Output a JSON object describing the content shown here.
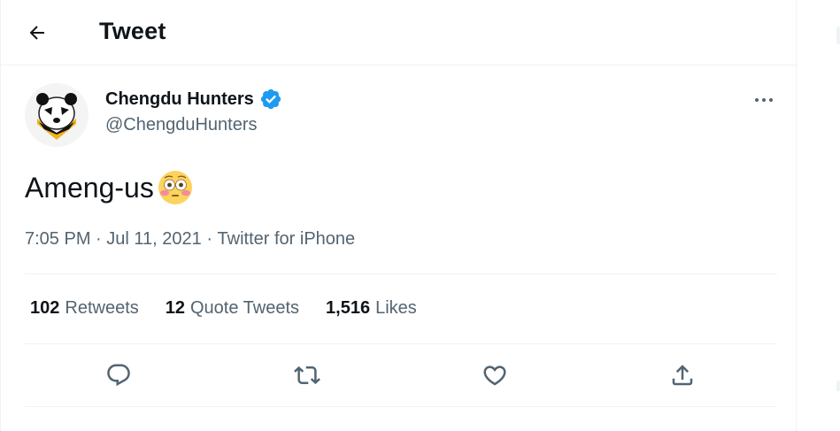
{
  "header": {
    "title": "Tweet",
    "back_icon": "arrow-left-icon"
  },
  "author": {
    "display_name": "Chengdu Hunters",
    "handle": "@ChengduHunters",
    "verified": true,
    "verified_color": "#1d9bf0",
    "avatar_icon": "panda-logo"
  },
  "tweet": {
    "text": "Ameng-us",
    "emoji": "flushed-face-emoji",
    "time": "7:05 PM",
    "date": "Jul 11, 2021",
    "source": "Twitter for iPhone",
    "separator": " · "
  },
  "stats": {
    "retweets_count": "102",
    "retweets_label": "Retweets",
    "quotes_count": "12",
    "quotes_label": "Quote Tweets",
    "likes_count": "1,516",
    "likes_label": "Likes"
  },
  "actions": [
    "reply-icon",
    "retweet-icon",
    "like-icon",
    "share-icon"
  ],
  "colors": {
    "text": "#0f1419",
    "secondary": "#536471",
    "border": "#eff3f4"
  }
}
